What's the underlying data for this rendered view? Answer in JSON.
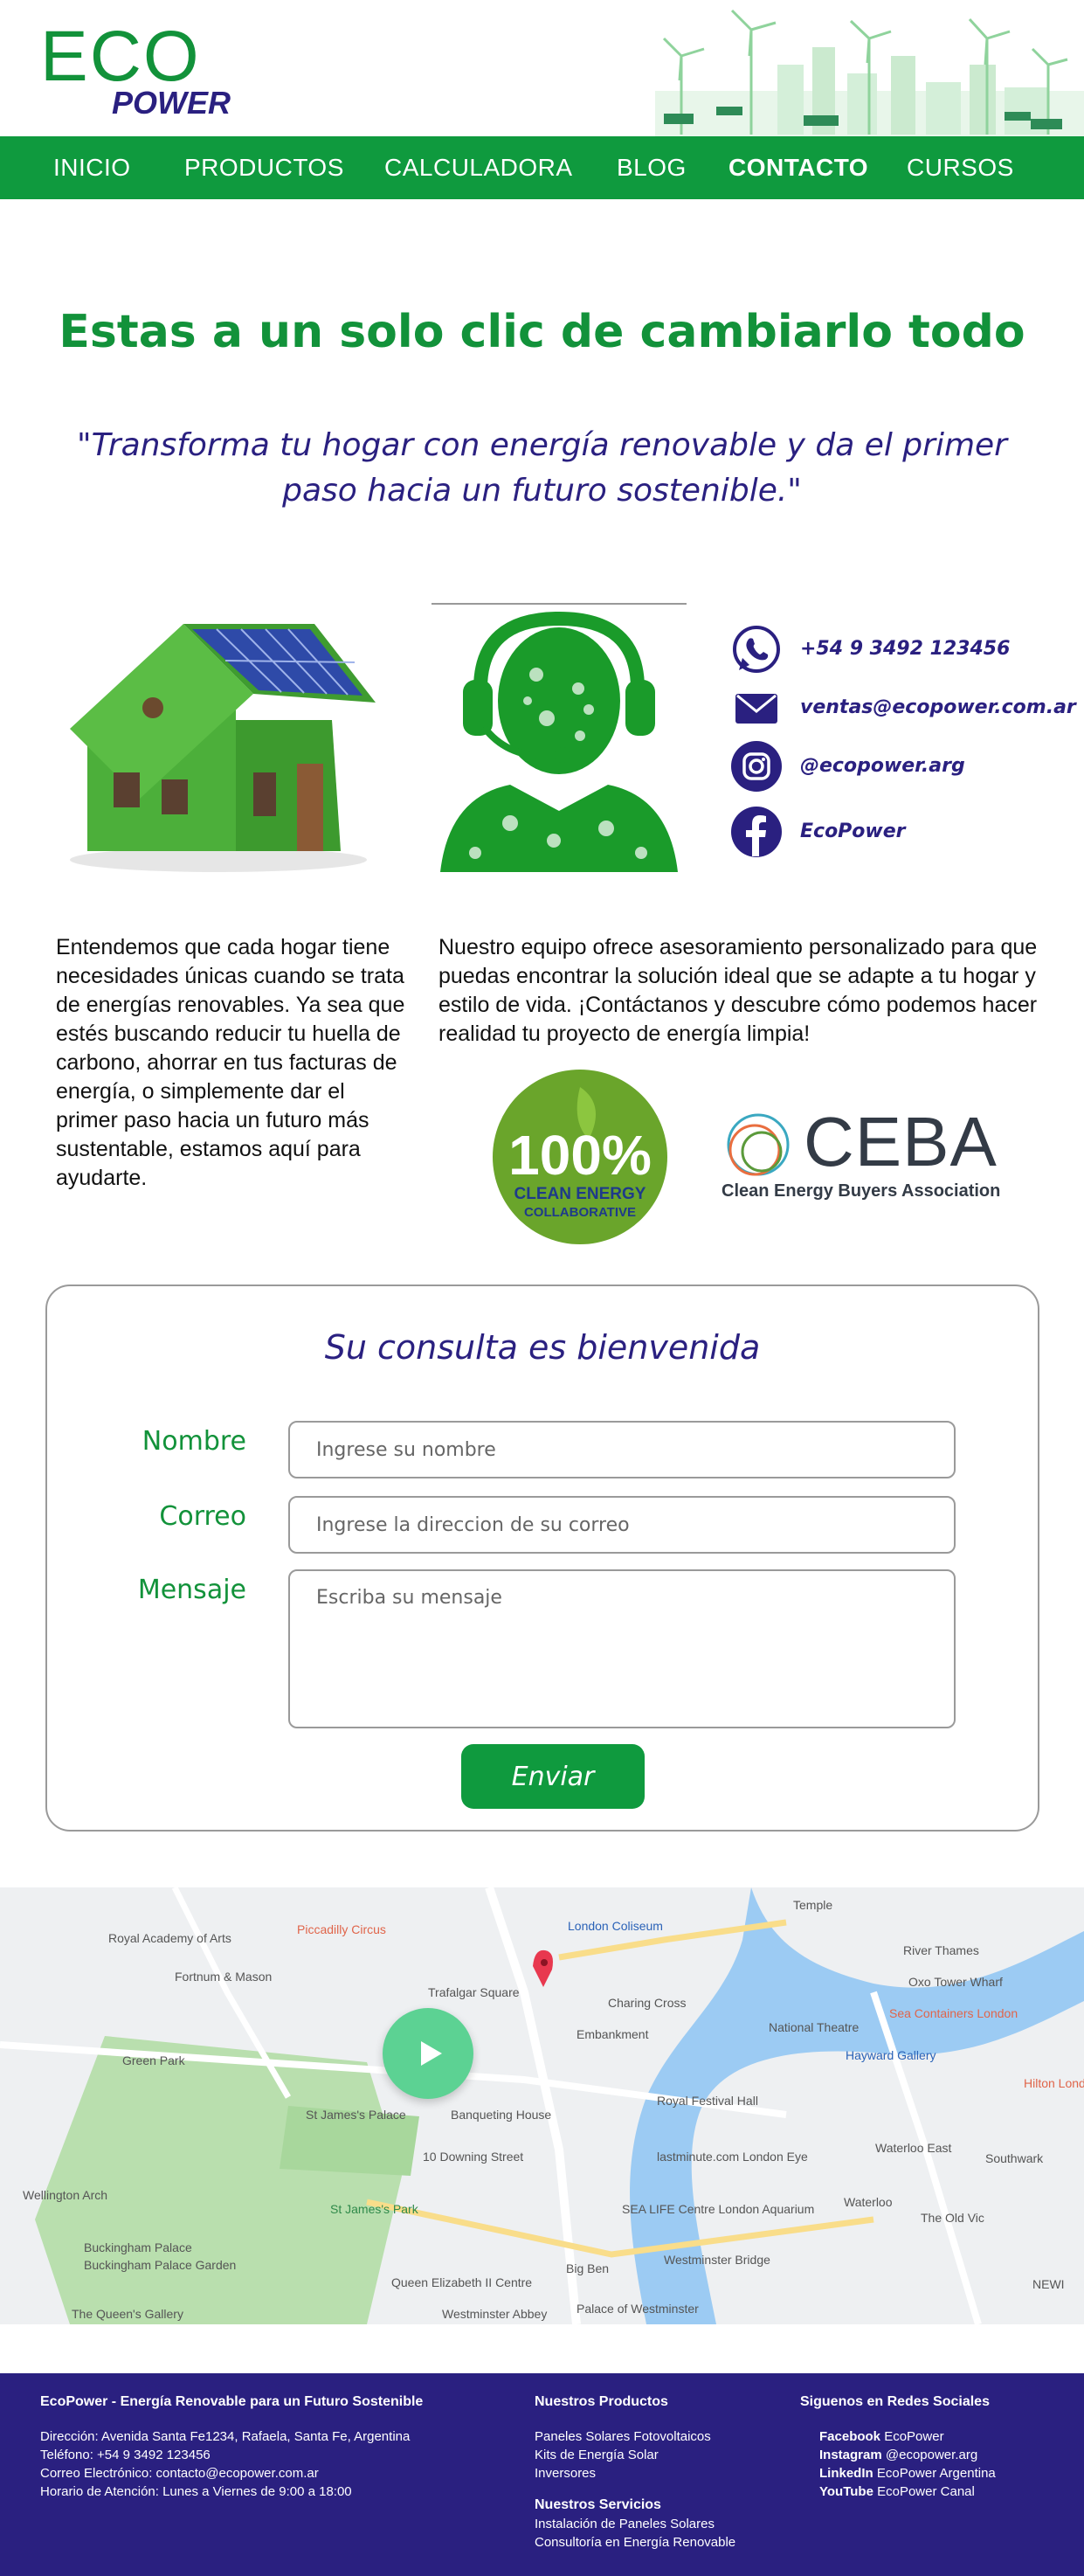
{
  "brand": {
    "eco": "ECO",
    "power": "POWER",
    "green": "#12923a",
    "navy": "#2a2080"
  },
  "nav": {
    "items": [
      {
        "label": "INICIO"
      },
      {
        "label": "PRODUCTOS"
      },
      {
        "label": "CALCULADORA"
      },
      {
        "label": "BLOG"
      },
      {
        "label": "CONTACTO",
        "active": true
      },
      {
        "label": "CURSOS"
      }
    ]
  },
  "hero": {
    "title": "Estas a un solo clic de cambiarlo todo",
    "quote": "\"Transforma tu hogar con energía renovable y da el primer paso hacia un futuro sostenible.\""
  },
  "contact": {
    "phone": "+54 9 3492 123456",
    "email": "ventas@ecopower.com.ar",
    "instagram": "@ecopower.arg",
    "facebook": "EcoPower",
    "icons": [
      "whatsapp-icon",
      "mail-icon",
      "instagram-icon",
      "facebook-icon"
    ]
  },
  "texts": {
    "left": "Entendemos que cada hogar tiene necesidades únicas cuando se trata de energías renovables. Ya sea que estés buscando reducir tu huella de carbono, ahorrar en tus facturas de energía, o simplemente dar el primer paso hacia un futuro más sustentable, estamos aquí para ayudarte.",
    "right": "Nuestro equipo ofrece asesoramiento personalizado para que puedas encontrar la solución ideal que se adapte a tu hogar y estilo de vida. ¡Contáctanos y descubre cómo podemos hacer realidad tu proyecto de energía limpia!"
  },
  "logos": {
    "badge_big": "100%",
    "badge_line1": "CLEAN ENERGY",
    "badge_line2": "COLLABORATIVE",
    "ceba": "CEBA",
    "ceba_sub": "Clean Energy Buyers Association"
  },
  "form": {
    "title": "Su consulta es bienvenida",
    "name_label": "Nombre",
    "name_placeholder": "Ingrese su nombre",
    "email_label": "Correo",
    "email_placeholder": "Ingrese la direccion de su correo",
    "message_label": "Mensaje",
    "message_placeholder": "Escriba su mensaje",
    "submit": "Enviar"
  },
  "map": {
    "labels": [
      "Royal Academy of Arts",
      "Piccadilly Circus",
      "London Coliseum",
      "Temple",
      "Fortnum & Mason",
      "Trafalgar Square",
      "Charing Cross",
      "River Thames",
      "Oxo Tower Wharf",
      "Sea Containers London",
      "National Theatre",
      "Green Park",
      "Embankment",
      "Hayward Gallery",
      "Hilton London Ba",
      "St James's Palace",
      "Banqueting House",
      "Royal Festival Hall",
      "10 Downing Street",
      "lastminute.com London Eye",
      "Waterloo East",
      "Southwark",
      "Wellington Arch",
      "St James's Park",
      "SEA LIFE Centre London Aquarium",
      "Waterloo",
      "The Old Vic",
      "Buckingham Palace",
      "Buckingham Palace Garden",
      "Big Ben",
      "Westminster Bridge",
      "Queen Elizabeth II Centre",
      "The Queen's Gallery",
      "Westminster Abbey",
      "Palace of Westminster",
      "NEWI"
    ]
  },
  "footer": {
    "col1_title": "EcoPower - Energía Renovable para un Futuro Sostenible",
    "address": "Dirección: Avenida Santa Fe1234, Rafaela, Santa Fe, Argentina",
    "phone": "Teléfono: +54 9 3492 123456",
    "email": "Correo Electrónico: contacto@ecopower.com.ar",
    "hours": "Horario de Atención: Lunes a Viernes de 9:00 a 18:00",
    "col2_title": "Nuestros Productos",
    "products": [
      "Paneles Solares Fotovoltaicos",
      "Kits de Energía Solar",
      "Inversores"
    ],
    "col2b_title": "Nuestros Servicios",
    "services": [
      "Instalación de Paneles Solares",
      "Consultoría en Energía Renovable"
    ],
    "col3_title": "Siguenos en Redes Sociales",
    "social": [
      {
        "net": "Facebook",
        "handle": "EcoPower"
      },
      {
        "net": "Instagram",
        "handle": "@ecopower.arg"
      },
      {
        "net": "LinkedIn",
        "handle": "EcoPower Argentina"
      },
      {
        "net": "YouTube",
        "handle": "EcoPower Canal"
      }
    ]
  }
}
